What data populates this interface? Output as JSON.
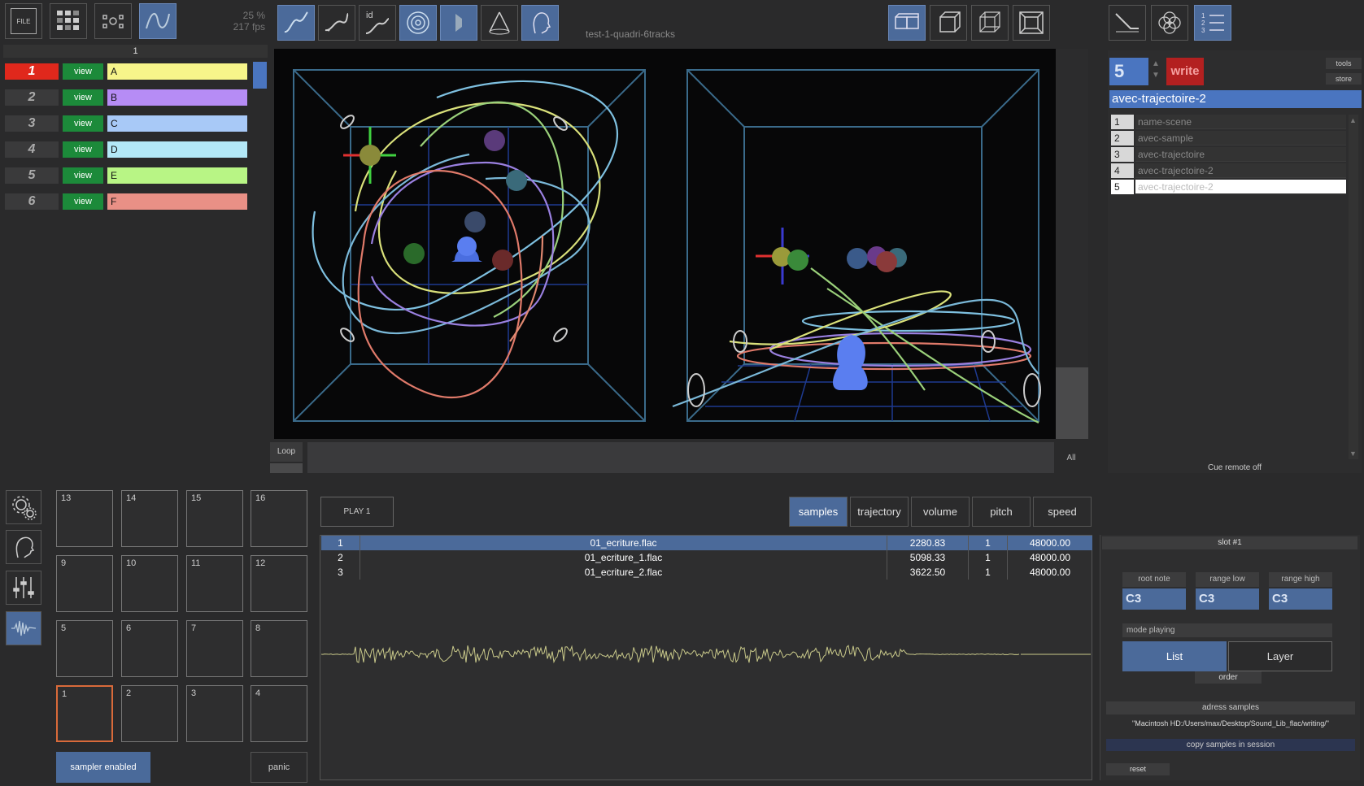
{
  "toolbar": {
    "file_label": "FILE",
    "fps_percent": "25 %",
    "fps_value": "217 fps",
    "session_title": "test-1-quadri-6tracks",
    "id_label": "id"
  },
  "tracks_header": "1",
  "tracks": [
    {
      "num": "1",
      "view": "view",
      "name": "A",
      "color": "#f7f58a"
    },
    {
      "num": "2",
      "view": "view",
      "name": "B",
      "color": "#b68cf5"
    },
    {
      "num": "3",
      "view": "view",
      "name": "C",
      "color": "#a8c9f7"
    },
    {
      "num": "4",
      "view": "view",
      "name": "D",
      "color": "#b3e8f7"
    },
    {
      "num": "5",
      "view": "view",
      "name": "E",
      "color": "#b8f585"
    },
    {
      "num": "6",
      "view": "view",
      "name": "F",
      "color": "#e99086"
    }
  ],
  "timeline": {
    "loop_label": "Loop",
    "all_label": "All"
  },
  "cues": {
    "current_number": "5",
    "write_label": "write",
    "tools_label": "tools",
    "store_label": "store",
    "current_name": "avec-trajectoire-2",
    "items": [
      {
        "n": "1",
        "name": "name-scene"
      },
      {
        "n": "2",
        "name": "avec-sample"
      },
      {
        "n": "3",
        "name": "avec-trajectoire"
      },
      {
        "n": "4",
        "name": "avec-trajectoire-2"
      },
      {
        "n": "5",
        "name": "avec-trajectoire-2"
      }
    ],
    "remote_status": "Cue remote off"
  },
  "pads": {
    "row1": [
      "13",
      "14",
      "15",
      "16"
    ],
    "row2": [
      "9",
      "10",
      "11",
      "12"
    ],
    "row3": [
      "5",
      "6",
      "7",
      "8"
    ],
    "row4": [
      "1",
      "2",
      "3",
      "4"
    ],
    "sampler_enabled_label": "sampler enabled",
    "panic_label": "panic"
  },
  "sampler": {
    "play_label": "PLAY 1",
    "tabs": [
      "samples",
      "trajectory",
      "volume",
      "pitch",
      "speed"
    ],
    "samples": [
      {
        "idx": "1",
        "file": "01_ecriture.flac",
        "duration": "2280.83",
        "ch": "1",
        "rate": "48000.00"
      },
      {
        "idx": "2",
        "file": "01_ecriture_1.flac",
        "duration": "5098.33",
        "ch": "1",
        "rate": "48000.00"
      },
      {
        "idx": "3",
        "file": "01_ecriture_2.flac",
        "duration": "3622.50",
        "ch": "1",
        "rate": "48000.00"
      }
    ]
  },
  "slot": {
    "title": "slot #1",
    "root_note_label": "root note",
    "range_low_label": "range low",
    "range_high_label": "range high",
    "root_note": "C3",
    "range_low": "C3",
    "range_high": "C3",
    "mode_label": "mode playing",
    "list_label": "List",
    "layer_label": "Layer",
    "order_label": "order",
    "address_label": "adress samples",
    "address_path": "\"Macintosh HD:/Users/max/Desktop/Sound_Lib_flac/writing/\"",
    "copy_label": "copy samples in session",
    "reset_label": "reset"
  }
}
